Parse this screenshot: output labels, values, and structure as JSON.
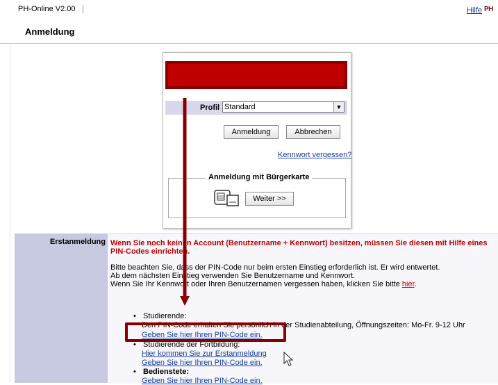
{
  "header": {
    "app_title": "PH-Online V2.00",
    "page_title": "Anmeldung",
    "help_link": "Hilfe",
    "logo_text": "PH"
  },
  "login": {
    "profile_label": "Profil",
    "profile_value": "Standard",
    "login_button": "Anmeldung",
    "cancel_button": "Abbrechen",
    "forgot_link": "Kennwort vergessen?",
    "card_legend": "Anmeldung mit Bürgerkarte",
    "next_button": "Weiter >>"
  },
  "info": {
    "side_label": "Erstanmeldung",
    "warning": "Wenn Sie noch keinen Account (Benutzername + Kennwort) besitzen, müssen Sie diesen mit Hilfe eines PIN-Codes einrichten.",
    "line1": "Bitte beachten Sie, dass der PIN-Code nur beim ersten Einstieg erforderlich ist. Er wird entwertet.",
    "line2": "Ab dem nächsten Einstieg verwenden Sie Benutzername und Kennwort.",
    "line3": "Wenn Sie Ihr Kennwort oder Ihren Benutzernamen vergessen haben, klicken Sie bitte",
    "line3_link": "hier",
    "line3_end": ".",
    "sections": [
      {
        "title": "Studierende:",
        "desc": "Den PIN-Code erhalten Sie persönlich in der Studienabteilung, Öffnungszeiten: Mo-Fr. 9-12 Uhr",
        "links": [
          "Geben Sie hier Ihren PIN-Code ein."
        ]
      },
      {
        "title": "Studierende der Fortbildung:",
        "links": [
          "Hier kommen Sie zur Erstanmeldung",
          "Geben Sie hier Ihren PIN-Code ein."
        ]
      },
      {
        "title": "Bedienstete:",
        "links": [
          "Geben Sie hier Ihren PIN-Code ein."
        ]
      }
    ]
  },
  "colors": {
    "banner_red": "#c00000",
    "annotation_red": "#8a0000",
    "link_blue": "#1a3e9a",
    "side_panel": "#c6c9df"
  }
}
